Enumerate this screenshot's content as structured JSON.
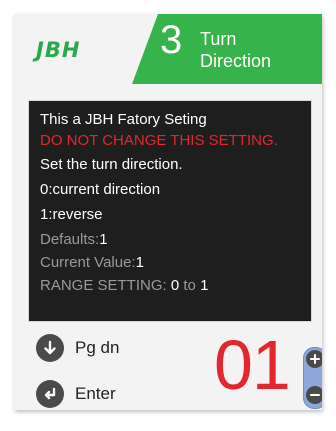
{
  "header": {
    "logo": "JBH",
    "param_number": "3",
    "param_title_line1": "Turn",
    "param_title_line2": "Direction"
  },
  "info": {
    "line1": "This a JBH Fatory Seting",
    "warning": "DO NOT CHANGE THIS SETTING.",
    "line3": "Set the turn direction.",
    "option0": "0:current direction",
    "option1": "1:reverse",
    "defaults_label": "Defaults:",
    "defaults_value": "1",
    "current_label": "Current Value:",
    "current_value": "1",
    "range_label": "RANGE SETTING: ",
    "range_min": "0",
    "range_to": " to ",
    "range_max": "1"
  },
  "controls": {
    "pgdn_label": "Pg dn",
    "enter_label": "Enter",
    "value_display": "01"
  },
  "colors": {
    "brand_green": "#36b34a",
    "warning_red": "#e3272f",
    "info_background": "#1e1e1e"
  },
  "icons": {
    "pgdn": "arrow-down-circle-icon",
    "enter": "enter-return-icon",
    "increment": "plus-icon",
    "decrement": "minus-icon"
  }
}
